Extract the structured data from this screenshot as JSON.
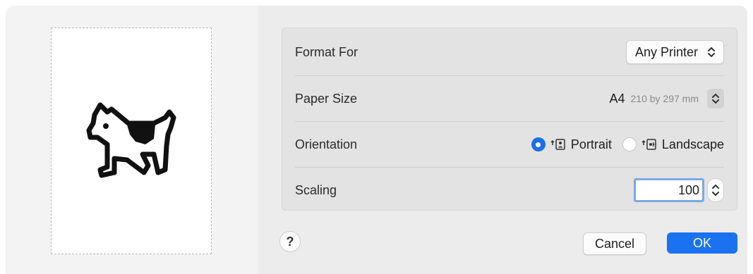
{
  "rows": {
    "format_for": {
      "label": "Format For",
      "value": "Any Printer"
    },
    "paper_size": {
      "label": "Paper Size",
      "name": "A4",
      "dimensions": "210 by 297 mm"
    },
    "orientation": {
      "label": "Orientation",
      "portrait": "Portrait",
      "landscape": "Landscape",
      "selected": "Portrait"
    },
    "scaling": {
      "label": "Scaling",
      "value": "100"
    }
  },
  "buttons": {
    "help": "?",
    "cancel": "Cancel",
    "ok": "OK"
  },
  "colors": {
    "accent": "#1a72f0",
    "focus_ring": "#7aa8e8",
    "panel": "#e3e3e3"
  },
  "icons": [
    "dogcow-icon",
    "updown-chevron-icon",
    "portrait-icon",
    "landscape-icon",
    "help-icon"
  ]
}
